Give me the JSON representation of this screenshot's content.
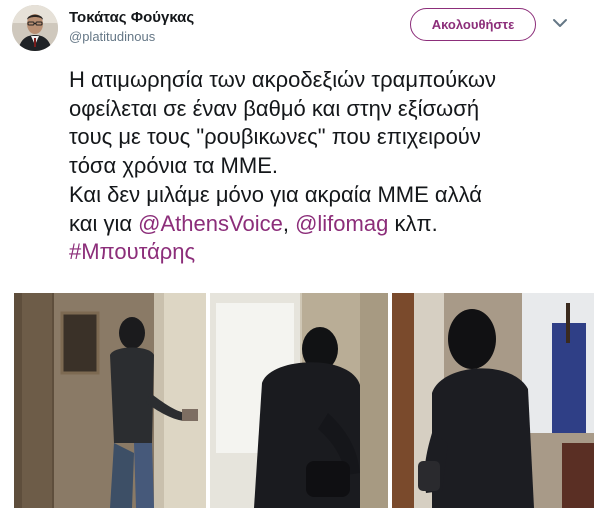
{
  "author": {
    "display_name": "Τοκάτας Φούγκας",
    "handle": "@platitudinous"
  },
  "follow_button": {
    "label": "Ακολουθήστε"
  },
  "menu_icon": "chevron-down-icon",
  "tweet": {
    "line1": "Η ατιμωρησία των ακροδεξιών τραμπούκων",
    "line2": "οφείλεται σε έναν βαθμό και στην εξίσωσή",
    "line3": "τους με τους \"ρουβικωνες\" που επιχειρούν",
    "line4": "τόσα χρόνια τα ΜΜΕ.",
    "line5": "Και δεν μιλάμε μόνο για ακραία ΜΜΕ αλλά",
    "line6_prefix": "και για ",
    "mention1": "@AthensVoice",
    "line6_separator": ", ",
    "mention2": "@lifomag",
    "line6_suffix": " κλπ.",
    "hashtag": "#Μπουτάρης"
  },
  "colors": {
    "accent": "#8c2e7a",
    "text": "#14171a",
    "secondary_text": "#657786"
  }
}
